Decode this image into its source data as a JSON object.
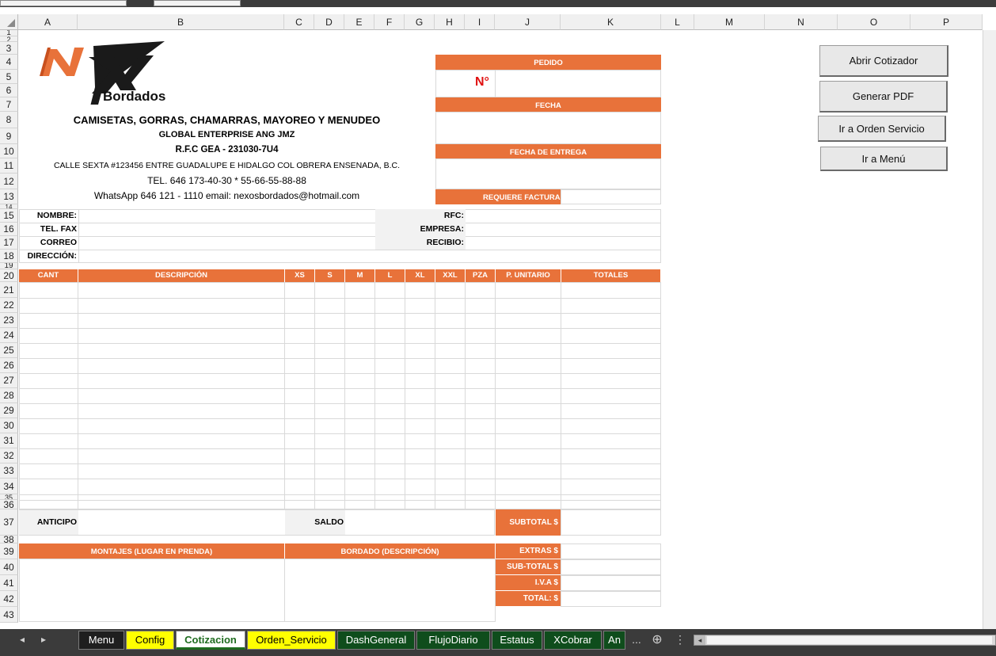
{
  "columns": [
    "A",
    "B",
    "C",
    "D",
    "E",
    "F",
    "G",
    "H",
    "I",
    "J",
    "K",
    "L",
    "M",
    "N",
    "O",
    "P"
  ],
  "rows": [
    "1",
    "2",
    "3",
    "4",
    "5",
    "6",
    "7",
    "8",
    "9",
    "10",
    "11",
    "12",
    "13",
    "14",
    "15",
    "16",
    "17",
    "18",
    "19",
    "20",
    "21",
    "22",
    "23",
    "24",
    "25",
    "26",
    "27",
    "28",
    "29",
    "30",
    "31",
    "32",
    "33",
    "34",
    "35",
    "36",
    "37",
    "38",
    "39",
    "40",
    "41",
    "42",
    "43"
  ],
  "logo": {
    "main": "NX",
    "sub": "Bordados"
  },
  "company": {
    "tagline": "CAMISETAS, GORRAS, CHAMARRAS, MAYOREO Y MENUDEO",
    "name": "GLOBAL ENTERPRISE ANG JMZ",
    "rfc": "R.F.C GEA - 231030-7U4",
    "address": "CALLE SEXTA #123456 ENTRE GUADALUPE E HIDALGO COL OBRERA ENSENADA, B.C.",
    "tel": "TEL. 646 173-40-30  *  55-66-55-88-88",
    "contact": "WhatsApp 646 121 - 1110  email: nexosbordados@hotmail.com"
  },
  "order": {
    "pedido": "PEDIDO",
    "numero": "N°",
    "fecha": "FECHA",
    "fecha_entrega": "FECHA DE ENTREGA",
    "requiere_factura": "REQUIERE FACTURA"
  },
  "client": {
    "nombre": "NOMBRE:",
    "tel_fax": "TEL. FAX",
    "correo": "CORREO",
    "direccion": "DIRECCIÓN:",
    "rfc": "RFC:",
    "empresa": "EMPRESA:",
    "recibio": "RECIBIO:"
  },
  "table_headers": [
    "CANT",
    "DESCRIPCIÓN",
    "XS",
    "S",
    "M",
    "L",
    "XL",
    "XXL",
    "PZA",
    "P. UNITARIO",
    "TOTALES"
  ],
  "footer": {
    "anticipo": "ANTICIPO",
    "saldo": "SALDO",
    "subtotal": "SUBTOTAL $",
    "montajes": "MONTAJES (LUGAR EN PRENDA)",
    "bordado": "BORDADO (DESCRIPCIÓN)",
    "extras": "EXTRAS $",
    "sub_total": "SUB-TOTAL $",
    "iva": "I.V.A $",
    "total": "TOTAL: $"
  },
  "buttons": {
    "abrir_cotizador": "Abrir Cotizador",
    "generar_pdf": "Generar PDF",
    "orden_servicio": "Ir a Orden Servicio",
    "menu": "Ir a Menú"
  },
  "sheet_tabs": [
    {
      "label": "Menu",
      "bg": "#1f1f1f",
      "fg": "#ffffff"
    },
    {
      "label": "Config",
      "bg": "#ffff00",
      "fg": "#000000"
    },
    {
      "label": "Cotizacion",
      "bg": "#ffffff",
      "fg": "#1e6b1e"
    },
    {
      "label": "Orden_Servicio",
      "bg": "#ffff00",
      "fg": "#000000"
    },
    {
      "label": "DashGeneral",
      "bg": "#0f4d1c",
      "fg": "#ffffff"
    },
    {
      "label": "FlujoDiario",
      "bg": "#0f4d1c",
      "fg": "#ffffff"
    },
    {
      "label": "Estatus",
      "bg": "#0f4d1c",
      "fg": "#ffffff"
    },
    {
      "label": "XCobrar",
      "bg": "#0f4d1c",
      "fg": "#ffffff"
    },
    {
      "label": "An",
      "bg": "#0f4d1c",
      "fg": "#ffffff"
    }
  ],
  "tab_nav": {
    "prev": "◂",
    "next": "▸",
    "more": "...",
    "add": "⊕",
    "options": "⋮",
    "scroll_left": "◂"
  },
  "colors": {
    "accent": "#e8723a",
    "red": "#e01010",
    "grid": "#d9d9d9"
  }
}
